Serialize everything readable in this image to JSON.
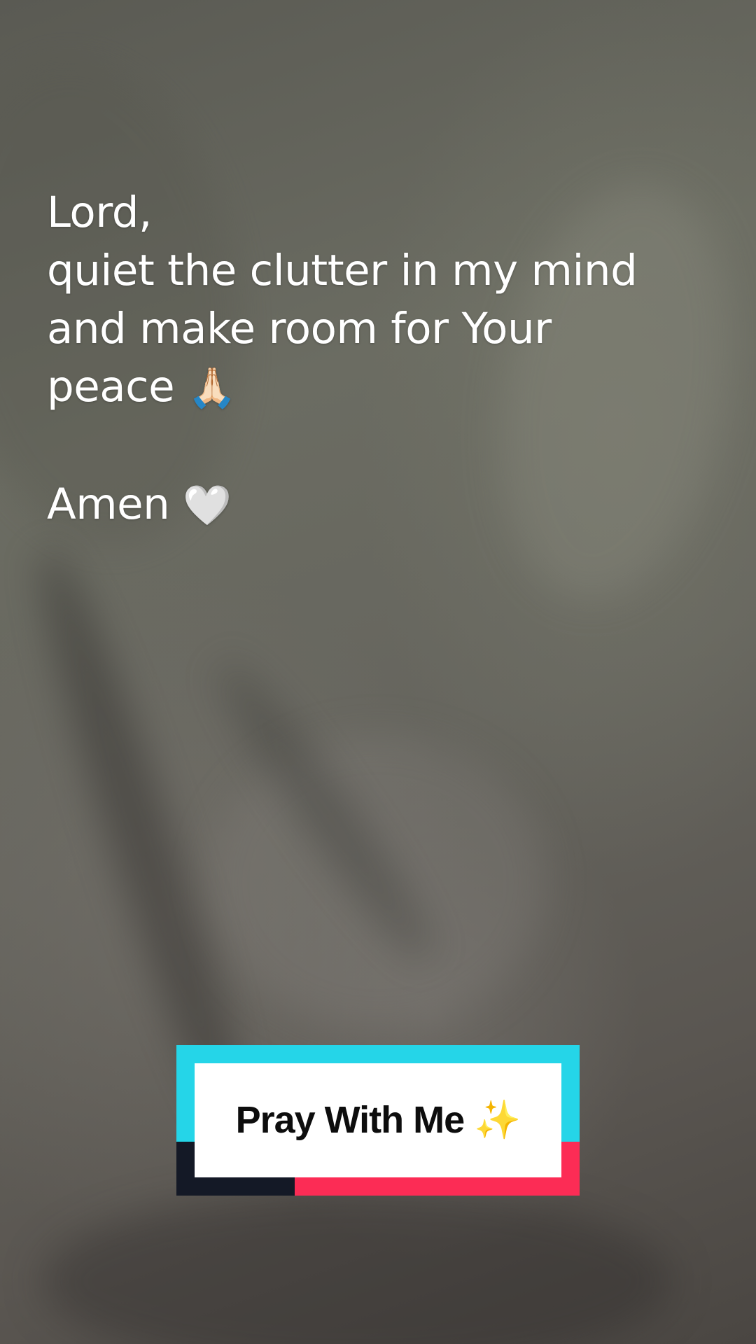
{
  "prayer": {
    "line1": "Lord,",
    "line2": "quiet the clutter in my mind",
    "line3": "and make room for Your",
    "line4_text": "peace",
    "line4_emoji": "🙏🏻",
    "closing_text": "Amen",
    "closing_emoji": "🤍"
  },
  "badge": {
    "label": "Pray With Me ✨",
    "colors": {
      "cyan": "#25d5e8",
      "red": "#fc2c55",
      "dark": "#141926",
      "card": "#ffffff"
    }
  },
  "icons": {
    "praying_hands": "praying-hands-icon",
    "white_heart": "white-heart-icon",
    "sparkles": "sparkles-icon"
  }
}
